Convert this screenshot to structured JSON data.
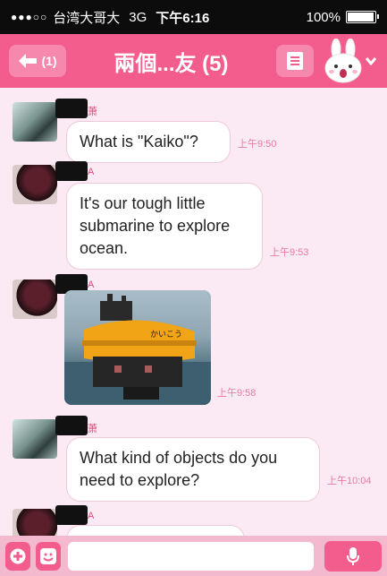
{
  "status_bar": {
    "signal": "●●●○○",
    "carrier": "台湾大哥大",
    "network": "3G",
    "time": "下午6:16",
    "battery_text": "100%",
    "battery_level": 1.0
  },
  "header": {
    "back_count": "(1)",
    "title": "兩個...友 (5)"
  },
  "messages": [
    {
      "sender_initial": "萧",
      "text": "What is \"Kaiko\"?",
      "time": "上午9:50"
    },
    {
      "sender_initial": "A",
      "text": "It's our tough little submarine to explore ocean.",
      "time": "上午9:53"
    },
    {
      "sender_initial": "A",
      "image": "yellow-submarine-photo",
      "time": "上午9:58"
    },
    {
      "sender_initial": "萧",
      "text": "What kind of objects do you need to explore?",
      "time": "上午10:04"
    },
    {
      "sender_initial": "A"
    }
  ],
  "input_bar": {
    "placeholder": ""
  },
  "colors": {
    "accent": "#f25d8e",
    "background": "#fbeaf3",
    "timestamp": "#e87ba0"
  }
}
